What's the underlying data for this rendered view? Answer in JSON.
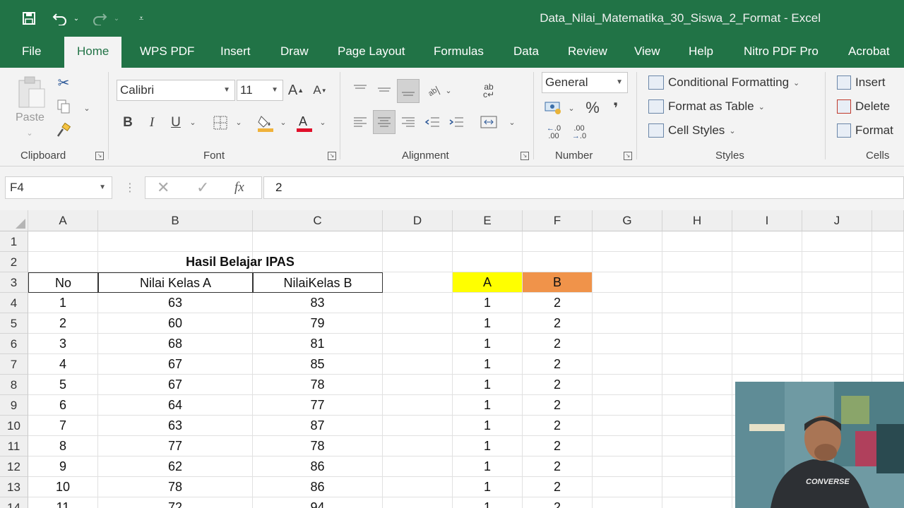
{
  "window": {
    "title": "Data_Nilai_Matematika_30_Siswa_2_Format  -  Excel"
  },
  "tabs": [
    "File",
    "Home",
    "WPS PDF",
    "Insert",
    "Draw",
    "Page Layout",
    "Formulas",
    "Data",
    "Review",
    "View",
    "Help",
    "Nitro PDF Pro",
    "Acrobat"
  ],
  "ribbon": {
    "clipboard": {
      "label": "Clipboard",
      "paste": "Paste"
    },
    "font": {
      "label": "Font",
      "name": "Calibri",
      "size": "11",
      "bold": "B",
      "italic": "I",
      "underline": "U"
    },
    "alignment": {
      "label": "Alignment"
    },
    "number": {
      "label": "Number",
      "format": "General",
      "percent": "%",
      "comma": "❜"
    },
    "styles": {
      "label": "Styles",
      "conditional": "Conditional Formatting",
      "format_table": "Format as Table",
      "cell_styles": "Cell Styles"
    },
    "cells": {
      "label": "Cells",
      "insert": "Insert",
      "delete": "Delete",
      "format": "Format"
    }
  },
  "formula_bar": {
    "name_box": "F4",
    "fx": "fx",
    "value": "2"
  },
  "grid": {
    "columns": [
      "A",
      "B",
      "C",
      "D",
      "E",
      "F",
      "G",
      "H",
      "I",
      "J"
    ],
    "rows": [
      "1",
      "2",
      "3",
      "4",
      "5",
      "6",
      "7",
      "8",
      "9",
      "10",
      "11",
      "12",
      "13",
      "14"
    ],
    "title": "Hasil Belajar IPAS",
    "headers": [
      "No",
      "Nilai Kelas A",
      "NilaiKelas B"
    ],
    "side_headers": [
      "A",
      "B"
    ],
    "data": [
      [
        "1",
        "63",
        "83",
        "1",
        "2"
      ],
      [
        "2",
        "60",
        "79",
        "1",
        "2"
      ],
      [
        "3",
        "68",
        "81",
        "1",
        "2"
      ],
      [
        "4",
        "67",
        "85",
        "1",
        "2"
      ],
      [
        "5",
        "67",
        "78",
        "1",
        "2"
      ],
      [
        "6",
        "64",
        "77",
        "1",
        "2"
      ],
      [
        "7",
        "63",
        "87",
        "1",
        "2"
      ],
      [
        "8",
        "77",
        "78",
        "1",
        "2"
      ],
      [
        "9",
        "62",
        "86",
        "1",
        "2"
      ],
      [
        "10",
        "78",
        "86",
        "1",
        "2"
      ],
      [
        "11",
        "72",
        "94",
        "1",
        "2"
      ]
    ],
    "colors": {
      "side_a": "#ffff00",
      "side_b": "#f0934a",
      "excel_green": "#217346"
    }
  },
  "webcam": {
    "shirt_text": "CONVERSE"
  }
}
